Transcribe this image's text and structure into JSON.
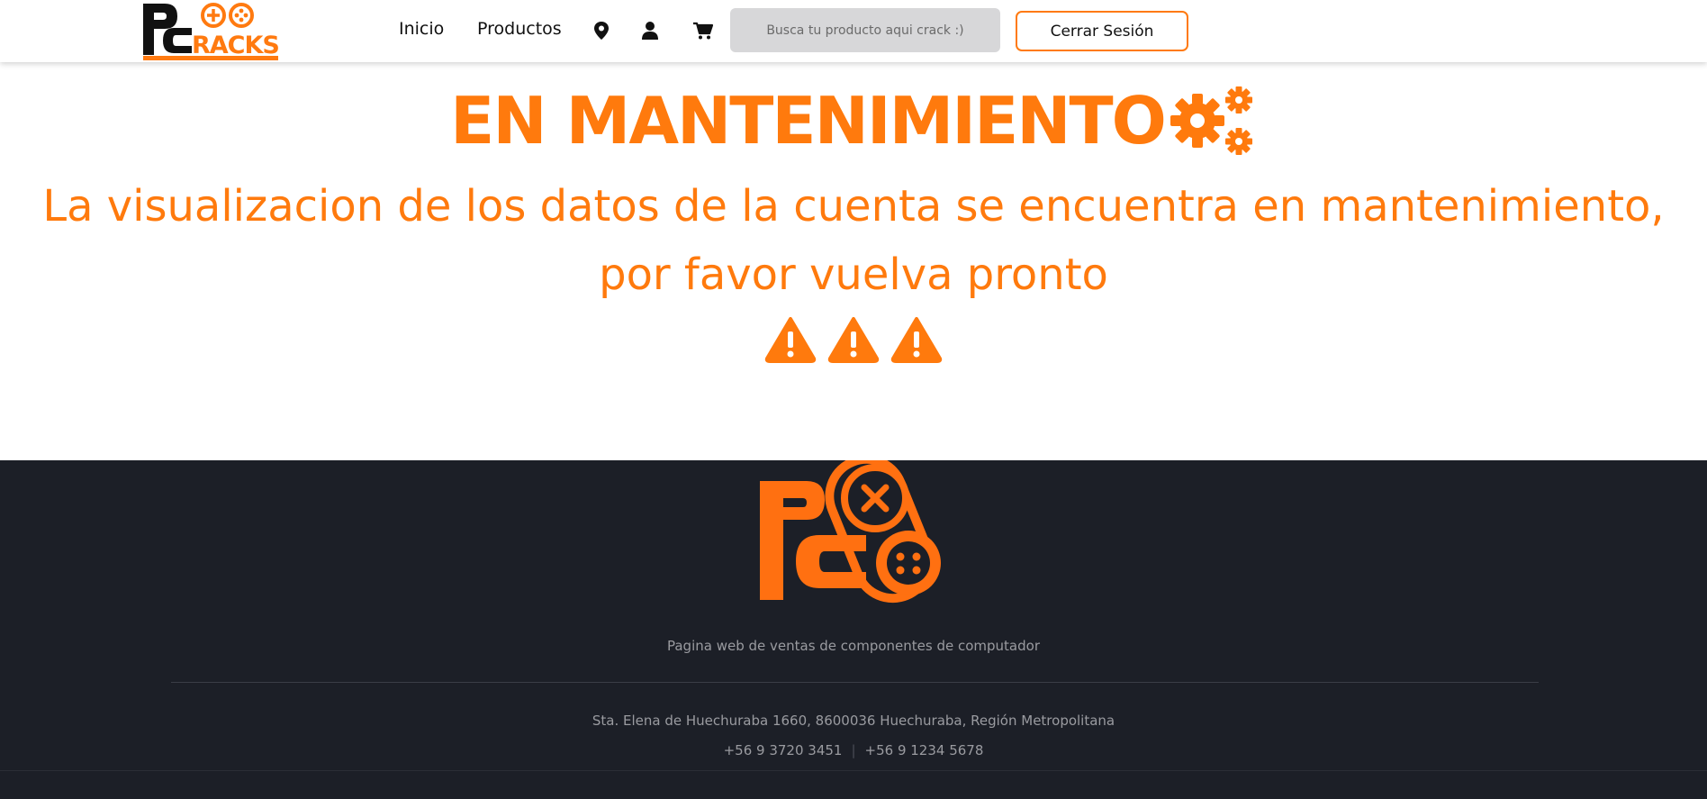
{
  "header": {
    "logo_text": "PCRACKS",
    "nav": [
      {
        "label": "Inicio"
      },
      {
        "label": "Productos"
      }
    ],
    "icons": [
      "map-pin-icon",
      "user-icon",
      "cart-icon"
    ],
    "search": {
      "placeholder": "Busca tu producto aqui crack :)",
      "value": ""
    },
    "logout_label": "Cerrar Sesión"
  },
  "main": {
    "title": "EN MANTENIMIENTO",
    "title_icon": "gears-icon",
    "message": "La visualizacion de los datos de la cuenta se encuentra en mantenimiento, por favor vuelva pronto",
    "warning_icons": [
      "warning-icon",
      "warning-icon",
      "warning-icon"
    ]
  },
  "footer": {
    "logo_text": "PC",
    "tagline": "Pagina web de ventas de componentes de computador",
    "address": "Sta. Elena de Huechuraba 1660, 8600036 Huechuraba, Región Metropolitana",
    "phones": [
      "+56 9 3720 3451",
      "+56 9 1234 5678"
    ]
  },
  "colors": {
    "accent": "#ff7a0d",
    "footer_bg": "#1c1f27",
    "search_bg": "#d7d7d9"
  }
}
